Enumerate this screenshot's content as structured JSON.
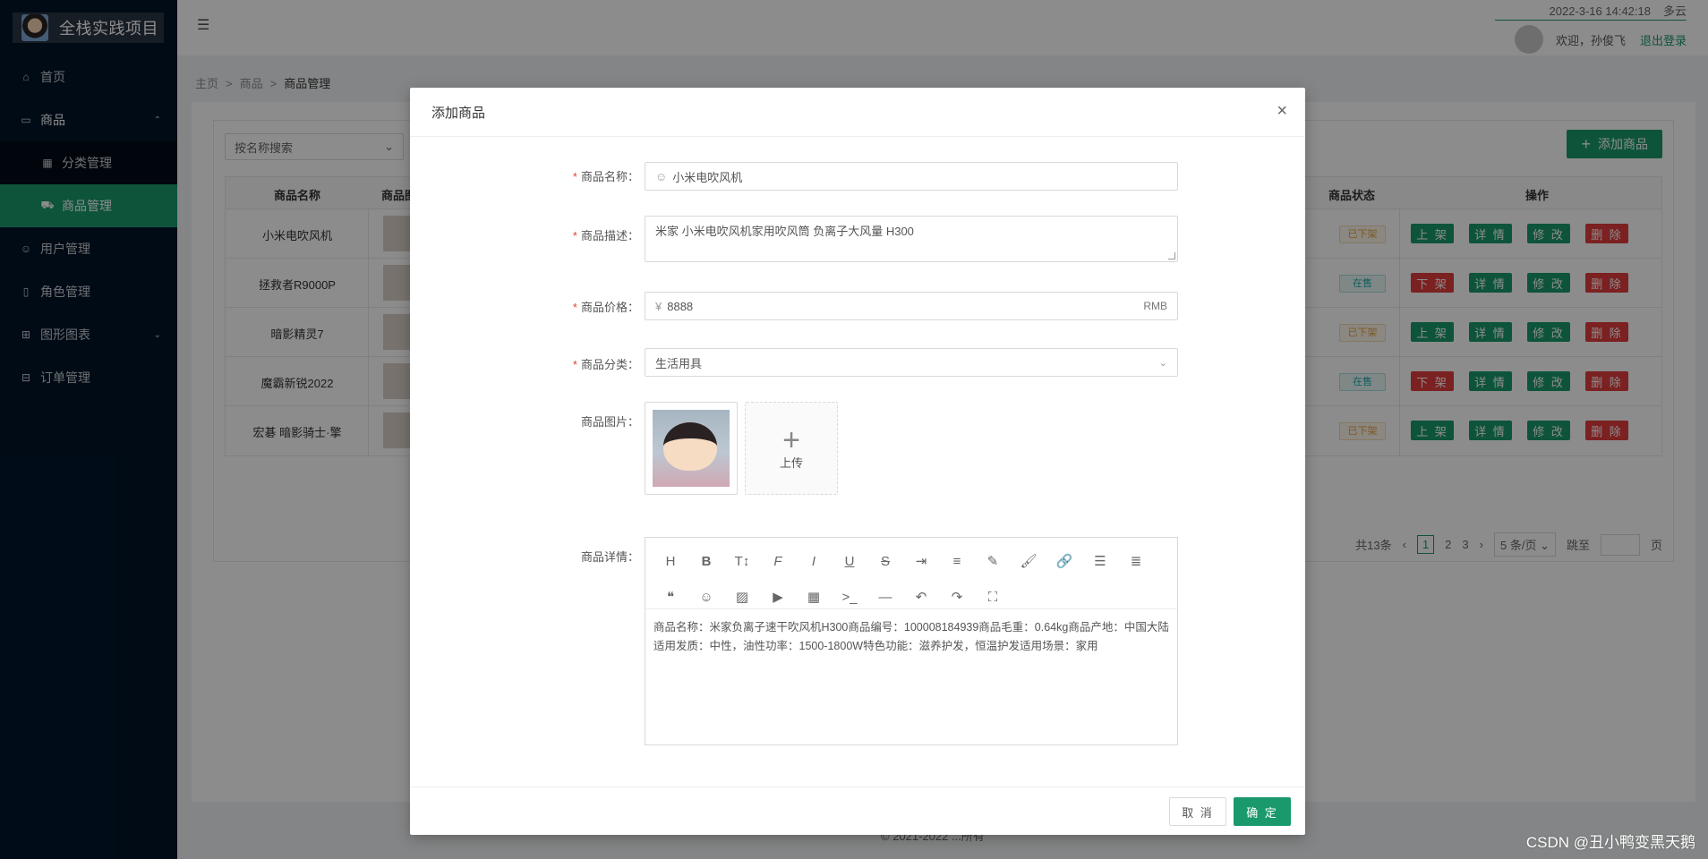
{
  "app": {
    "title": "全栈实践项目"
  },
  "sidebar": {
    "items": [
      {
        "label": "首页",
        "icon": "home-icon"
      },
      {
        "label": "商品",
        "icon": "shop-icon"
      },
      {
        "label": "分类管理",
        "icon": "table-icon"
      },
      {
        "label": "商品管理",
        "icon": "cart-icon"
      },
      {
        "label": "用户管理",
        "icon": "user-icon"
      },
      {
        "label": "角色管理",
        "icon": "doc-icon"
      },
      {
        "label": "图形图表",
        "icon": "grid-icon"
      },
      {
        "label": "订单管理",
        "icon": "lock-icon"
      }
    ]
  },
  "header": {
    "date": "2022-3-16 14:42:18",
    "weather": "多云",
    "welcome": "欢迎，孙俊飞",
    "logout": "退出登录"
  },
  "breadcrumb": {
    "items": [
      "主页",
      "商品",
      "商品管理"
    ],
    "sep": ">"
  },
  "main": {
    "search_placeholder": "按名称搜索",
    "add_button": "添加商品",
    "columns": {
      "name": "商品名称",
      "image": "商品图",
      "status": "商品状态",
      "ops": "操作"
    },
    "rows": [
      {
        "name": "小米电吹风机",
        "status": "已下架",
        "status_type": "off",
        "toggle": "上 架"
      },
      {
        "name": "拯救者R9000P",
        "status": "在售",
        "status_type": "on",
        "toggle": "下 架"
      },
      {
        "name": "暗影精灵7",
        "status": "已下架",
        "status_type": "off",
        "toggle": "上 架"
      },
      {
        "name": "魔霸新锐2022",
        "status": "在售",
        "status_type": "on",
        "toggle": "下 架"
      },
      {
        "name": "宏碁 暗影骑士·擎",
        "status": "已下架",
        "status_type": "off",
        "toggle": "上 架"
      }
    ],
    "ops": {
      "detail": "详 情",
      "edit": "修 改",
      "delete": "删 除"
    },
    "pagination": {
      "total": "共13条",
      "pages": [
        "1",
        "2",
        "3"
      ],
      "page_size": "5 条/页",
      "jump": "跳至",
      "page_unit": "页"
    },
    "footer": "© 2021-2022 ...所有"
  },
  "modal": {
    "title": "添加商品",
    "fields": {
      "name_label": "商品名称",
      "name_value": "小米电吹风机",
      "desc_label": "商品描述",
      "desc_value": "米家 小米电吹风机家用吹风筒 负离子大风量 H300",
      "price_label": "商品价格",
      "price_prefix": "¥",
      "price_value": "8888",
      "price_suffix": "RMB",
      "category_label": "商品分类",
      "category_value": "生活用具",
      "image_label": "商品图片",
      "upload_label": "上传",
      "detail_label": "商品详情",
      "detail_value": "商品名称：米家负离子速干吹风机H300商品编号：100008184939商品毛重：0.64kg商品产地：中国大陆适用发质：中性，油性功率：1500-1800W特色功能：滋养护发，恒温护发适用场景：家用"
    },
    "toolbar_icons": [
      "heading-icon",
      "bold-icon",
      "font-size-icon",
      "font-family-icon",
      "italic-icon",
      "underline-icon",
      "strikethrough-icon",
      "indent-icon",
      "line-height-icon",
      "text-color-icon",
      "bg-color-icon",
      "link-icon",
      "list-icon",
      "align-icon",
      "quote-icon",
      "emoji-icon",
      "image-icon",
      "video-icon",
      "table-icon",
      "code-icon",
      "divider-icon",
      "undo-icon",
      "redo-icon",
      "fullscreen-icon"
    ],
    "cancel": "取 消",
    "ok": "确 定"
  },
  "watermark": "CSDN @丑小鸭变黑天鹅",
  "colors": {
    "accent": "#1a9a6c",
    "danger": "#e03c3c",
    "sidebar": "#001529"
  }
}
